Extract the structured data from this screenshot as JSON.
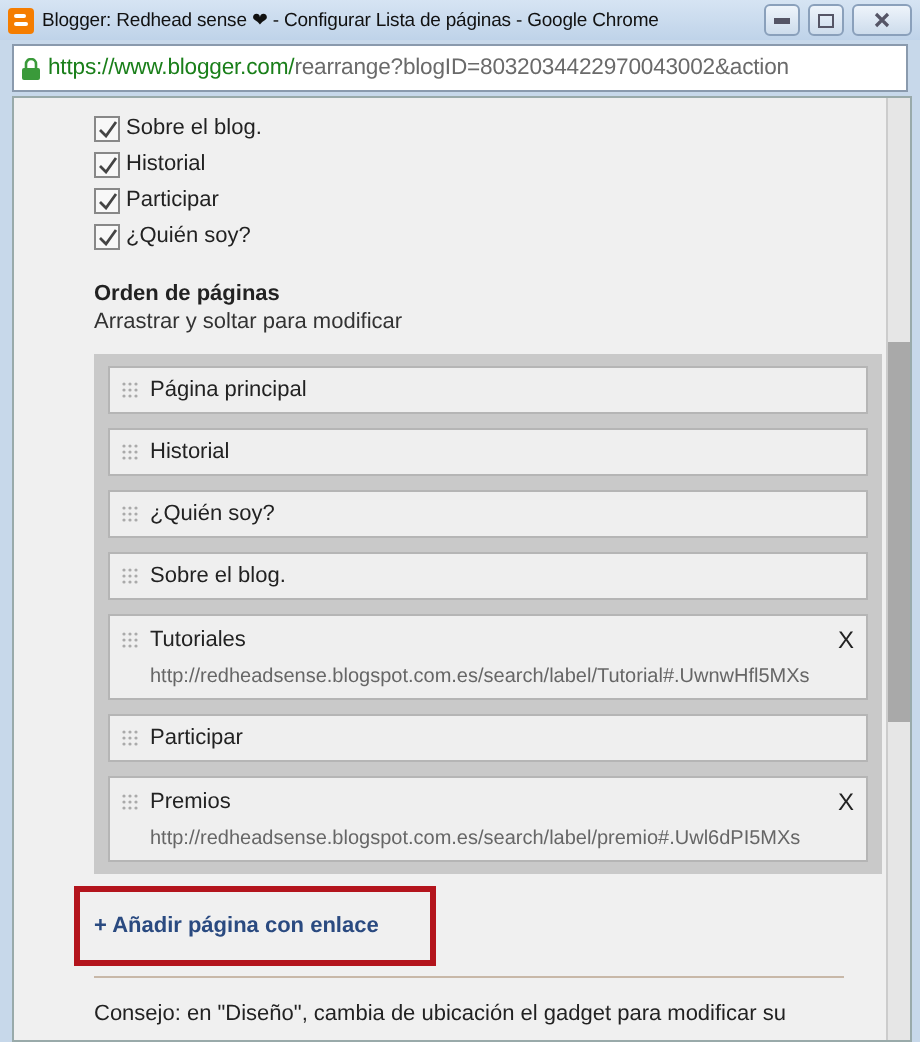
{
  "window": {
    "title": "Blogger: Redhead sense ❤ - Configurar Lista de páginas - Google Chrome"
  },
  "address_bar": {
    "host": "https://www.blogger.com/",
    "path": "rearrange?blogID=8032034422970043002&action"
  },
  "page_checks": [
    {
      "label": "Sobre el blog.",
      "checked": true
    },
    {
      "label": "Historial",
      "checked": true
    },
    {
      "label": "Participar",
      "checked": true
    },
    {
      "label": "¿Quién soy?",
      "checked": true
    }
  ],
  "order": {
    "title": "Orden de páginas",
    "hint": "Arrastrar y soltar para modificar",
    "items": [
      {
        "label": "Página principal"
      },
      {
        "label": "Historial"
      },
      {
        "label": "¿Quién soy?"
      },
      {
        "label": "Sobre el blog."
      },
      {
        "label": "Tutoriales",
        "url": "http://redheadsense.blogspot.com.es/search/label/Tutorial#.UwnwHfl5MXs",
        "remove": "X"
      },
      {
        "label": "Participar"
      },
      {
        "label": "Premios",
        "url": "http://redheadsense.blogspot.com.es/search/label/premio#.Uwl6dPI5MXs",
        "remove": "X"
      }
    ]
  },
  "add_link": {
    "label": "+ Añadir página con enlace",
    "highlighted": true
  },
  "tip": "Consejo: en \"Diseño\", cambia de ubicación el gadget para modificar su"
}
